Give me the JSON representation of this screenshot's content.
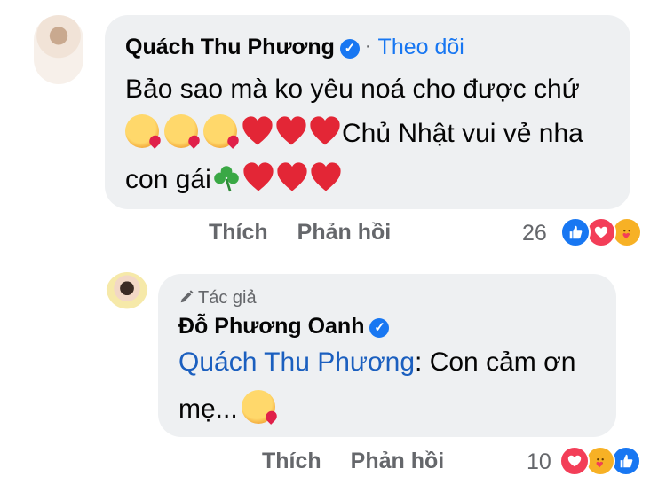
{
  "comment": {
    "author": "Quách Thu Phương",
    "follow_label": "Theo dõi",
    "line1": "Bảo sao mà ko yêu noá cho được chứ",
    "line2_text": "Chủ Nhật vui vẻ nha",
    "line3_text": "con gái",
    "like_action": "Thích",
    "reply_action": "Phản hồi",
    "reaction_count": "26",
    "reactions": [
      "like",
      "love",
      "care"
    ]
  },
  "reply": {
    "author_tag": "Tác giả",
    "author": "Đỗ Phương Oanh",
    "mention": "Quách Thu Phương",
    "text_after_mention": ": Con cảm ơn",
    "line2_text": "mẹ...",
    "like_action": "Thích",
    "reply_action": "Phản hồi",
    "reaction_count": "10",
    "reactions": [
      "love",
      "care",
      "like"
    ]
  },
  "colors": {
    "bubble": "#eef0f2",
    "link": "#1877f2",
    "mention": "#1b5fbf",
    "muted": "#65676b"
  }
}
